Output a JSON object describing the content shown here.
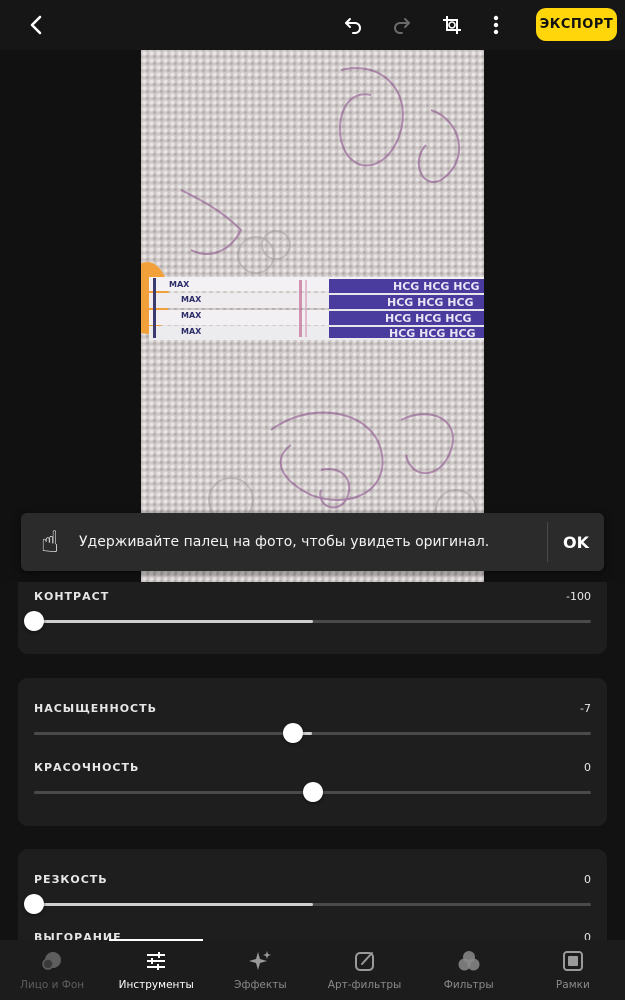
{
  "topbar": {
    "back_icon": "chevron-left-icon",
    "undo_icon": "undo-icon",
    "redo_icon": "redo-icon",
    "crop_icon": "crop-icon",
    "more_icon": "more-vertical-icon",
    "export_label": "ЭКСПОРТ"
  },
  "photo": {
    "strip_labels": [
      "MAX",
      "MAX",
      "MAX",
      "MAX"
    ],
    "brand_text": "HCG HCG HCG"
  },
  "toast": {
    "emoji": "☝",
    "message": "Удерживайте палец на фото, чтобы увидеть оригинал.",
    "ok_label": "OK"
  },
  "adjustments": {
    "contrast": {
      "label": "КОНТРАСТ",
      "value": "-100",
      "level": 0.0
    },
    "saturation": {
      "label": "НАСЫЩЕННОСТЬ",
      "value": "-7",
      "level": 0.465
    },
    "vibrance": {
      "label": "КРАСОЧНОСТЬ",
      "value": "0",
      "level": 0.5
    },
    "sharpness": {
      "label": "РЕЗКОСТЬ",
      "value": "0",
      "level": 0.0
    },
    "fade": {
      "label": "ВЫГОРАНИЕ",
      "value": "0",
      "level": 0.0
    }
  },
  "bottom_nav": {
    "items": [
      {
        "label": "Лицо и Фон",
        "icon": "face-background-icon",
        "state": "dim"
      },
      {
        "label": "Инструменты",
        "icon": "sliders-icon",
        "state": "active"
      },
      {
        "label": "Эффекты",
        "icon": "sparkles-icon",
        "state": "normal"
      },
      {
        "label": "Арт-фильтры",
        "icon": "art-brush-icon",
        "state": "normal"
      },
      {
        "label": "Фильтры",
        "icon": "filters-circles-icon",
        "state": "normal"
      },
      {
        "label": "Рамки",
        "icon": "frame-icon",
        "state": "normal"
      }
    ]
  },
  "colors": {
    "accent": "#ffd60a",
    "background": "#121212",
    "card": "#1e1e1e"
  }
}
